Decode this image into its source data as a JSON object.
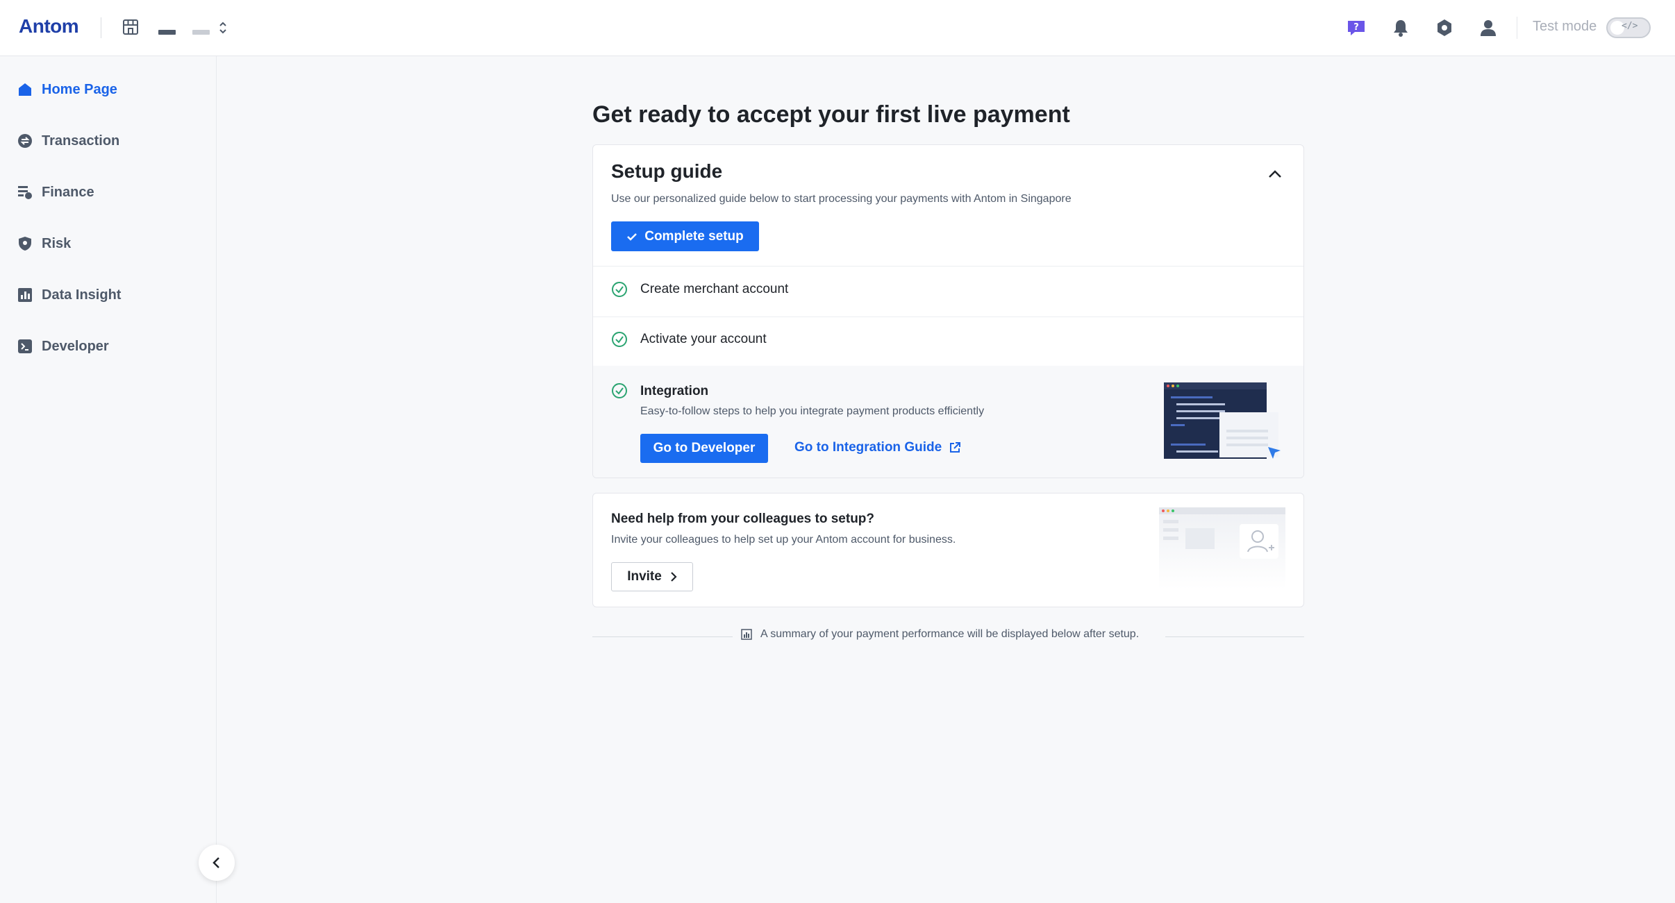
{
  "header": {
    "logo_text": "Antom",
    "merchant_selector_icon": "updown-chevron-icon",
    "store_icon": "store-icon",
    "icons": [
      "help-chat-icon",
      "bell-icon",
      "gear-icon",
      "user-icon"
    ],
    "test_mode_label": "Test mode",
    "test_mode_toggle_text": "</>",
    "test_mode_on": false
  },
  "sidebar": {
    "items": [
      {
        "label": "Home Page",
        "icon": "home-icon",
        "active": true
      },
      {
        "label": "Transaction",
        "icon": "transaction-icon",
        "active": false
      },
      {
        "label": "Finance",
        "icon": "finance-icon",
        "active": false
      },
      {
        "label": "Risk",
        "icon": "shield-icon",
        "active": false
      },
      {
        "label": "Data Insight",
        "icon": "chart-icon",
        "active": false
      },
      {
        "label": "Developer",
        "icon": "terminal-icon",
        "active": false
      }
    ],
    "collapse_icon": "chevron-left-icon"
  },
  "main": {
    "title": "Get ready to accept your first live payment",
    "setup_guide": {
      "title": "Setup guide",
      "description": "Use our personalized guide below to start processing your payments with Antom in Singapore",
      "complete_button": "Complete setup",
      "steps": [
        {
          "label": "Create merchant account",
          "done": true
        },
        {
          "label": "Activate your account",
          "done": true
        },
        {
          "label": "Integration",
          "done": true,
          "description": "Easy-to-follow steps to help you integrate payment products efficiently",
          "primary_button": "Go to Developer",
          "link": "Go to Integration Guide"
        }
      ]
    },
    "help": {
      "title": "Need help from your colleagues to setup?",
      "description": "Invite your colleagues to help set up your Antom account for business.",
      "invite_button": "Invite"
    },
    "summary_text": "A summary of your payment performance will be displayed below after setup."
  },
  "colors": {
    "primary": "#1a6cf0",
    "success": "#2ba471",
    "text": "#1f2329",
    "muted": "#4e5969"
  }
}
